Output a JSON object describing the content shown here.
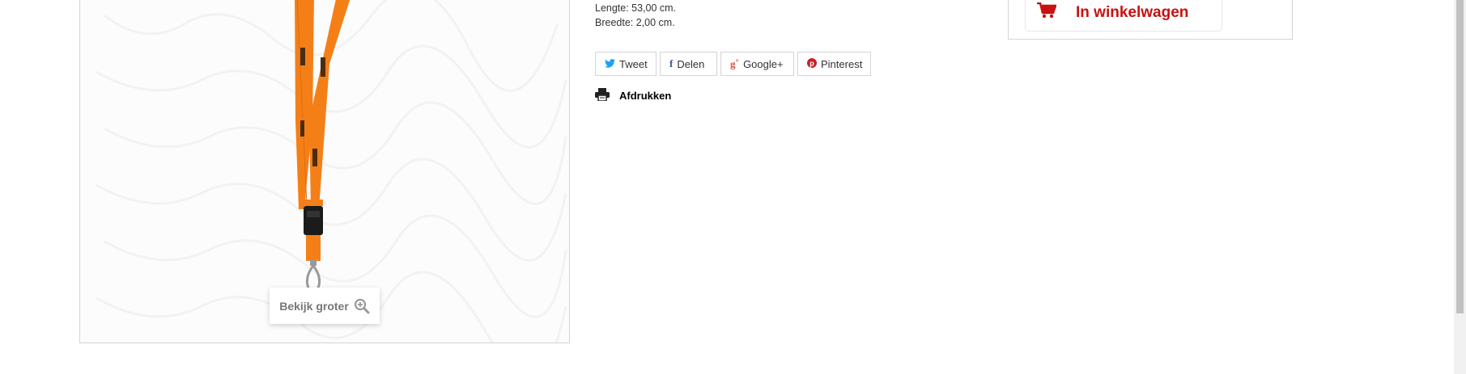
{
  "product": {
    "zoom_label": "Bekijk groter",
    "dimensions": {
      "length": "Lengte: 53,00 cm.",
      "width": "Breedte: 2,00 cm."
    }
  },
  "share": {
    "tweet": "Tweet",
    "facebook": "Delen",
    "google": "Google+",
    "pinterest": "Pinterest"
  },
  "print_label": "Afdrukken",
  "cart": {
    "label": "In winkelwagen"
  },
  "colors": {
    "accent_red": "#c81111",
    "lanyard_orange": "#f57f17",
    "twitter": "#1da1f2",
    "facebook": "#3b5998",
    "google": "#dd4b39",
    "pinterest": "#cb2027"
  },
  "icons": {
    "twitter": "twitter-icon",
    "facebook": "facebook-icon",
    "google": "google-plus-icon",
    "pinterest": "pinterest-icon",
    "print": "printer-icon",
    "cart": "cart-icon",
    "zoom": "zoom-in-icon"
  }
}
